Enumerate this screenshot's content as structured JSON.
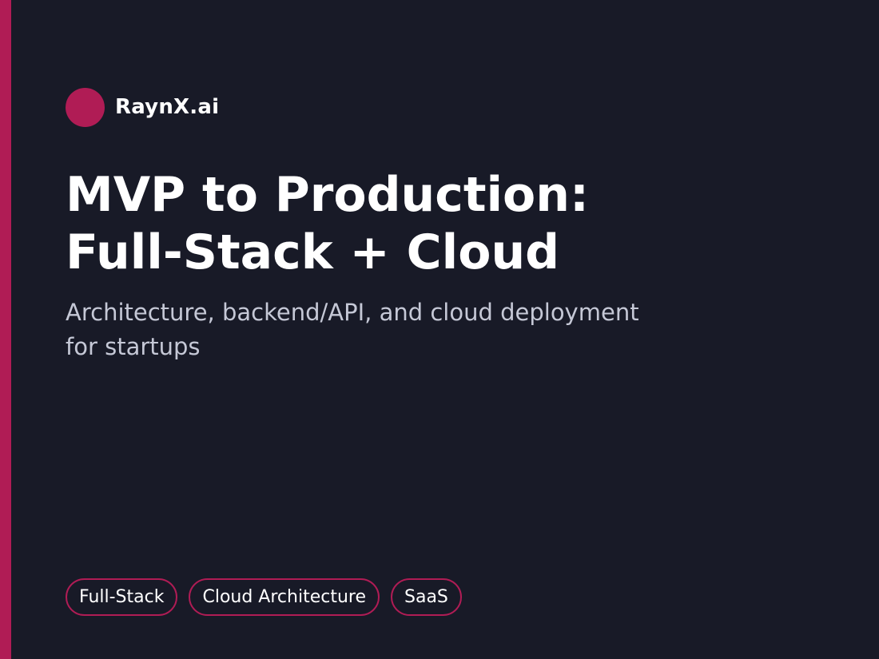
{
  "brand": {
    "name": "RaynX.ai"
  },
  "title": {
    "line1": "MVP to Production:",
    "line2": "Full-Stack + Cloud"
  },
  "subtitle": {
    "line1": "Architecture, backend/API, and cloud deployment",
    "line2": "for startups"
  },
  "tags": [
    "Full-Stack",
    "Cloud Architecture",
    "SaaS"
  ],
  "colors": {
    "background": "#181a27",
    "accent": "#b01c55",
    "text": "#ffffff",
    "muted_text": "#c5c8d6"
  }
}
